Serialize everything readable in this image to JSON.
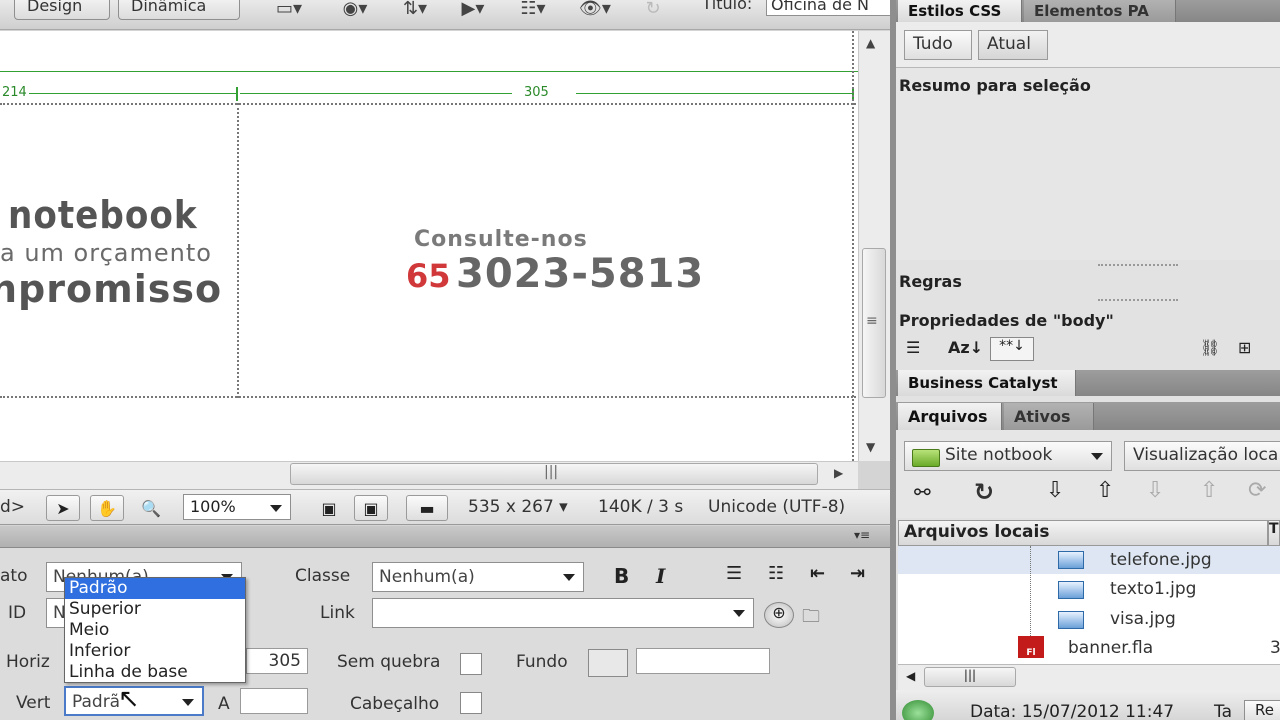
{
  "toolbar": {
    "design_label": "Design",
    "dynamic_label": "Dinâmica",
    "title_label": "Título:",
    "title_value": "Oficina de N"
  },
  "canvas": {
    "ruler_left": "214",
    "ruler_right": "305",
    "banner_line1": "notebook",
    "banner_line2": "a um orçamento",
    "banner_line3": "npromisso",
    "consult_label": "Consulte-nos",
    "phone_area": "65",
    "phone_number": "3023-5813"
  },
  "statusbar": {
    "tag_selector": "d>",
    "zoom": "100%",
    "dimensions": "535 x 267",
    "size_time": "140K / 3 s",
    "encoding": "Unicode (UTF-8)"
  },
  "properties": {
    "format_label": "ato",
    "format_value": "Nenhum(a)",
    "id_label": "ID",
    "id_value": "N",
    "class_label": "Classe",
    "class_value": "Nenhum(a)",
    "link_label": "Link",
    "link_value": "",
    "horiz_label": "Horiz",
    "width_value": "305",
    "nowrap_label": "Sem quebra",
    "bg_label": "Fundo",
    "bg_value": "",
    "vert_label": "Vert",
    "vert_value": "Padrã",
    "height_label": "A",
    "height_value": "",
    "header_label": "Cabeçalho"
  },
  "vert_dropdown": {
    "options": [
      "Padrão",
      "Superior",
      "Meio",
      "Inferior",
      "Linha de base"
    ],
    "selected_index": 0
  },
  "dock": {
    "tabs_top": [
      "Estilos CSS",
      "Elementos PA"
    ],
    "mode_all": "Tudo",
    "mode_current": "Atual",
    "summary_title": "Resumo para seleção",
    "rules_title": "Regras",
    "props_title": "Propriedades de \"body\"",
    "bc_tab": "Business Catalyst",
    "files_tabs": [
      "Arquivos",
      "Ativos"
    ],
    "site_select": "Site notbook",
    "view_select": "Visualização loca",
    "local_files_header": "Arquivos locais",
    "files": [
      {
        "name": "telefone.jpg"
      },
      {
        "name": "texto1.jpg"
      },
      {
        "name": "visa.jpg"
      },
      {
        "name": "banner.fla",
        "extra": "3"
      }
    ],
    "footer_date": "Data: 15/07/2012 11:47",
    "footer_size": "Ta",
    "footer_btn": "Re"
  },
  "colors": {
    "accent_green": "#33a033",
    "phone_red": "#d0383a",
    "selection_blue": "#2f6fe0"
  }
}
